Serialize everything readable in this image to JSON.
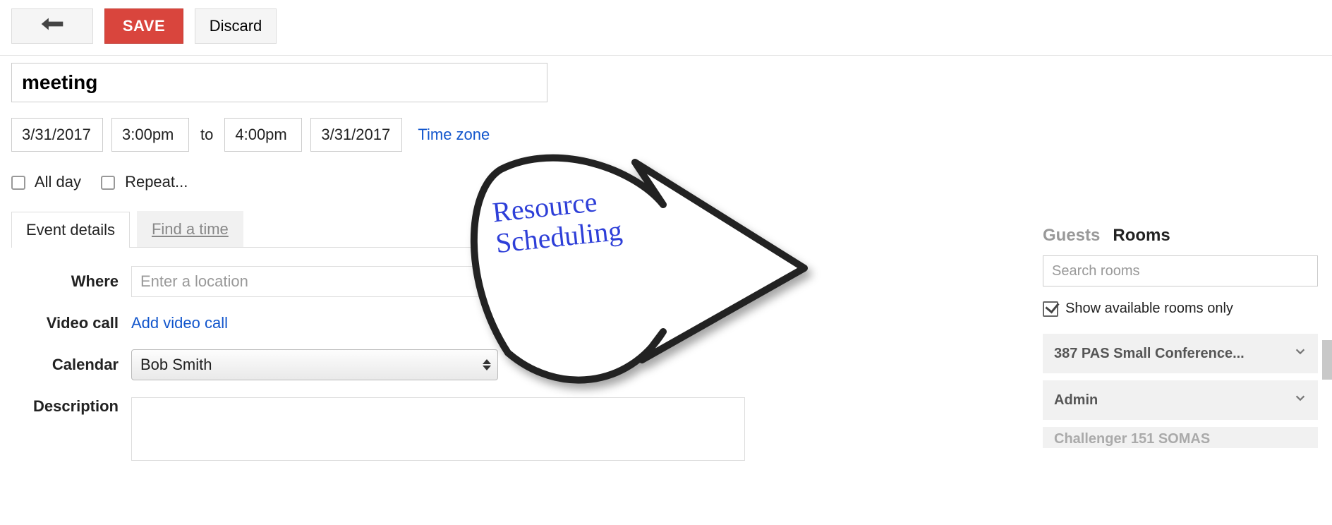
{
  "toolbar": {
    "save_label": "SAVE",
    "discard_label": "Discard"
  },
  "event": {
    "title": "meeting",
    "start_date": "3/31/2017",
    "start_time": "3:00pm",
    "to_label": "to",
    "end_time": "4:00pm",
    "end_date": "3/31/2017",
    "timezone_link": "Time zone",
    "all_day_label": "All day",
    "repeat_label": "Repeat..."
  },
  "tabs": {
    "details": "Event details",
    "find_time": "Find a time"
  },
  "details": {
    "where_label": "Where",
    "where_placeholder": "Enter a location",
    "video_label": "Video call",
    "video_link": "Add video call",
    "calendar_label": "Calendar",
    "calendar_value": "Bob Smith",
    "description_label": "Description"
  },
  "right": {
    "guests_tab": "Guests",
    "rooms_tab": "Rooms",
    "search_placeholder": "Search rooms",
    "available_only_label": "Show available rooms only",
    "rooms": {
      "0": "387 PAS Small Conference...",
      "1": "Admin",
      "2": "Challenger 151 SOMAS"
    }
  },
  "annotation": {
    "line1": "Resource",
    "line2": "Scheduling"
  }
}
